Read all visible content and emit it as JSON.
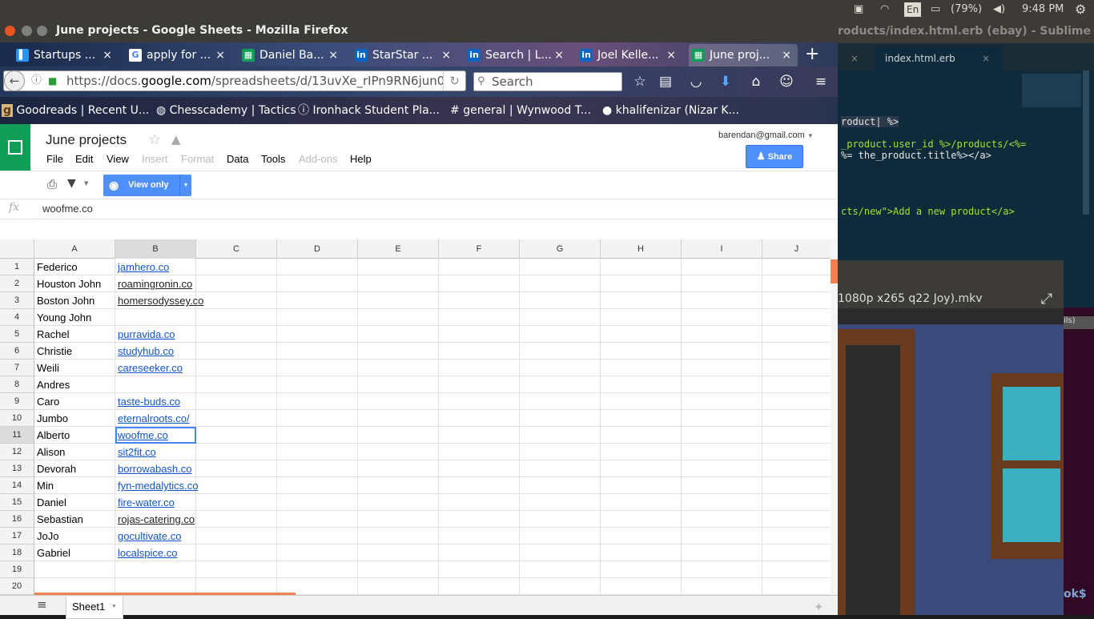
{
  "topbar": {
    "keyboard": "En",
    "battery": "(79%)",
    "time": "9:48 PM"
  },
  "sublime": {
    "title": "roducts/index.html.erb (ebay) - Sublime Te",
    "tab": "index.html.erb",
    "lines": [
      "roduct| %>",
      "_product.user_id %>/products/<%=",
      "%= the_product.title%></a>",
      "cts/new\">Add a new product</a>"
    ]
  },
  "video": {
    "title": "1080p x265 q22 Joy).mkv",
    "side": "ils)"
  },
  "terminal": {
    "prompt": "ok$"
  },
  "firefox": {
    "window_title": "June projects - Google Sheets - Mozilla Firefox",
    "tabs": [
      {
        "label": "Startups ...",
        "icon": "bookmark-icon",
        "color": "#2196f3"
      },
      {
        "label": "apply for ...",
        "icon": "google-icon",
        "color": "#ffffff"
      },
      {
        "label": "Daniel Ba...",
        "icon": "sheets-icon",
        "color": "#0f9d58"
      },
      {
        "label": "StarStar ...",
        "icon": "linkedin-icon",
        "color": "#0a66c2"
      },
      {
        "label": "Search | L...",
        "icon": "linkedin-icon",
        "color": "#0a66c2"
      },
      {
        "label": "Joel Kelle...",
        "icon": "linkedin-icon",
        "color": "#0a66c2"
      },
      {
        "label": "June proj...",
        "icon": "sheets-icon",
        "color": "#0f9d58"
      }
    ],
    "url_prefix": "https://docs.",
    "url_domain": "google.com",
    "url_rest": "/spreadsheets/d/13uvXe_rIPn9RN6jun0",
    "search_placeholder": "Search",
    "bookmarks": [
      "Goodreads | Recent U...",
      "Chesscademy | Tactics",
      "Ironhack Student Pla...",
      "general | Wynwood T...",
      "khalifenizar (Nizar K..."
    ]
  },
  "sheet": {
    "title": "June projects",
    "menu": {
      "file": "File",
      "edit": "Edit",
      "view": "View",
      "insert": "Insert",
      "format": "Format",
      "data": "Data",
      "tools": "Tools",
      "addons": "Add-ons",
      "help": "Help"
    },
    "user": "barendan@gmail.com",
    "share": "Share",
    "view_only": "View only",
    "formula_label": "fx",
    "formula_value": "woofme.co",
    "columns": [
      "A",
      "B",
      "C",
      "D",
      "E",
      "F",
      "G",
      "H",
      "I",
      "J"
    ],
    "rows": [
      {
        "n": "1",
        "a": "Federico",
        "b": "jamhero.co",
        "link": true
      },
      {
        "n": "2",
        "a": "Houston John",
        "b": "roamingronin.co",
        "link": false
      },
      {
        "n": "3",
        "a": "Boston John",
        "b": "homersodyssey.co",
        "link": false
      },
      {
        "n": "4",
        "a": "Young John",
        "b": "",
        "link": false
      },
      {
        "n": "5",
        "a": "Rachel",
        "b": "purravida.co",
        "link": true
      },
      {
        "n": "6",
        "a": "Christie",
        "b": "studyhub.co",
        "link": true
      },
      {
        "n": "7",
        "a": "Weili",
        "b": "careseeker.co",
        "link": true
      },
      {
        "n": "8",
        "a": "Andres",
        "b": "",
        "link": false
      },
      {
        "n": "9",
        "a": "Caro",
        "b": "taste-buds.co",
        "link": true
      },
      {
        "n": "10",
        "a": "Jumbo",
        "b": "eternalroots.co/",
        "link": true
      },
      {
        "n": "11",
        "a": "Alberto",
        "b": "woofme.co",
        "link": true
      },
      {
        "n": "12",
        "a": "Alison",
        "b": "sit2fit.co",
        "link": true
      },
      {
        "n": "13",
        "a": "Devorah",
        "b": "borrowabash.co",
        "link": true
      },
      {
        "n": "14",
        "a": "Min",
        "b": "fyn-medalytics.co",
        "link": true
      },
      {
        "n": "15",
        "a": "Daniel",
        "b": "fire-water.co",
        "link": true
      },
      {
        "n": "16",
        "a": "Sebastian",
        "b": "rojas-catering.co",
        "link": false
      },
      {
        "n": "17",
        "a": "JoJo",
        "b": "gocultivate.co",
        "link": true
      },
      {
        "n": "18",
        "a": "Gabriel",
        "b": "localspice.co",
        "link": true
      },
      {
        "n": "19",
        "a": "",
        "b": "",
        "link": false
      },
      {
        "n": "20",
        "a": "",
        "b": "",
        "link": false
      }
    ],
    "sheet_tab": "Sheet1",
    "accent": "#4d90fe"
  }
}
